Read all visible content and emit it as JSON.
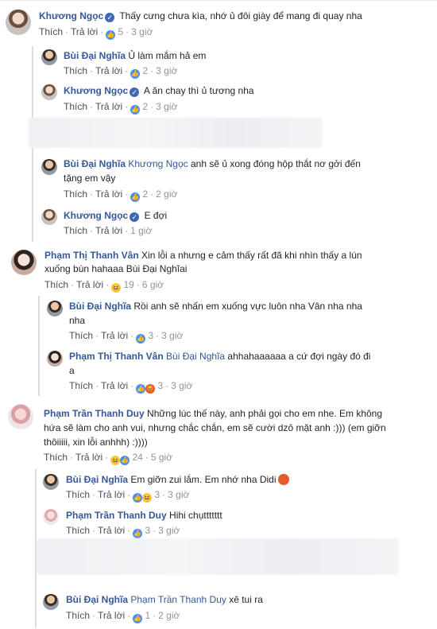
{
  "comments": [
    {
      "name": "Khương Ngọc",
      "verified": true,
      "text": "Thấy cưng chưa kìa, nhớ ủ đôi giày để mang đi quay nha",
      "like": "Thích",
      "reply": "Trả lời",
      "count": "5",
      "time": "3 giờ"
    },
    {
      "name": "Bùi Đại Nghĩa",
      "verified": false,
      "text": "Ủ làm mắm hả em",
      "like": "Thích",
      "reply": "Trả lời",
      "count": "2",
      "time": "3 giờ"
    },
    {
      "name": "Khương Ngọc",
      "verified": true,
      "text": "A ăn chay thì ủ tương nha",
      "like": "Thích",
      "reply": "Trả lời",
      "count": "2",
      "time": "3 giờ"
    },
    {
      "name": "Bùi Đại Nghĩa",
      "verified": false,
      "mention": "Khương Ngọc",
      "text1": "anh sẽ ủ xong đóng hộp thắt nơ gởi đến",
      "text2": "tặng em vậy",
      "like": "Thích",
      "reply": "Trả lời",
      "count": "2",
      "time": "2 giờ"
    },
    {
      "name": "Khương Ngọc",
      "verified": true,
      "text": "E đợi",
      "like": "Thích",
      "reply": "Trả lời",
      "count": "",
      "time": "1 giờ"
    },
    {
      "name": "Phạm Thị Thanh Vân",
      "text1": "Xin lỗi a nhưng e cảm thấy rất đã khi nhìn thấy a lún",
      "text2": "xuống bùn hahaaa Bùi Đại Nghĩai",
      "like": "Thích",
      "reply": "Trả lời",
      "count": "19",
      "time": "6 giờ"
    },
    {
      "name": "Bùi Đại Nghĩa",
      "text1": "Rồi anh sẽ nhấn em xuống vực luôn nha Vân nha nha",
      "text2": "nha",
      "like": "Thích",
      "reply": "Trả lời",
      "count": "3",
      "time": "3 giờ"
    },
    {
      "name": "Phạm Thị Thanh Vân",
      "mention": "Bùi Đại Nghĩa",
      "text1": "ahhahaaaaaa a cứ đợi ngày đó đi",
      "text2": "a",
      "like": "Thích",
      "reply": "Trả lời",
      "count": "3",
      "time": "3 giờ"
    },
    {
      "name": "Phạm Trần Thanh Duy",
      "text1": "Những lúc thế này, anh phải gọi cho em nhe. Em không",
      "text2": "hứa sẽ làm cho anh vui, nhưng chắc chắn, em sẽ cười dzô mặt anh :))) (em giỡn",
      "text3": "thôiiiii, xin lỗi anhhh) :))))",
      "like": "Thích",
      "reply": "Trả lời",
      "count": "24",
      "time": "5 giờ"
    },
    {
      "name": "Bùi Đại Nghĩa",
      "text": "Em giỡn zui lắm. Em nhớ nha Didi",
      "like": "Thích",
      "reply": "Trả lời",
      "count": "3",
      "time": "3 giờ"
    },
    {
      "name": "Phạm Trần Thanh Duy",
      "text": "Hihi chụttttttt",
      "like": "Thích",
      "reply": "Trả lời",
      "count": "3",
      "time": "3 giờ"
    },
    {
      "name": "Bùi Đại Nghĩa",
      "mention": "Phạm Trần Thanh Duy",
      "text": "xê tui ra",
      "like": "Thích",
      "reply": "Trả lời",
      "count": "1",
      "time": "2 giờ"
    }
  ],
  "colors": {
    "name": "#365899",
    "meta": "#90949c",
    "like": "#4a8ef6"
  },
  "icons": {
    "verified": "verified-check-icon",
    "like": "like-reaction-icon",
    "haha": "haha-reaction-icon",
    "angry": "angry-reaction-icon"
  }
}
